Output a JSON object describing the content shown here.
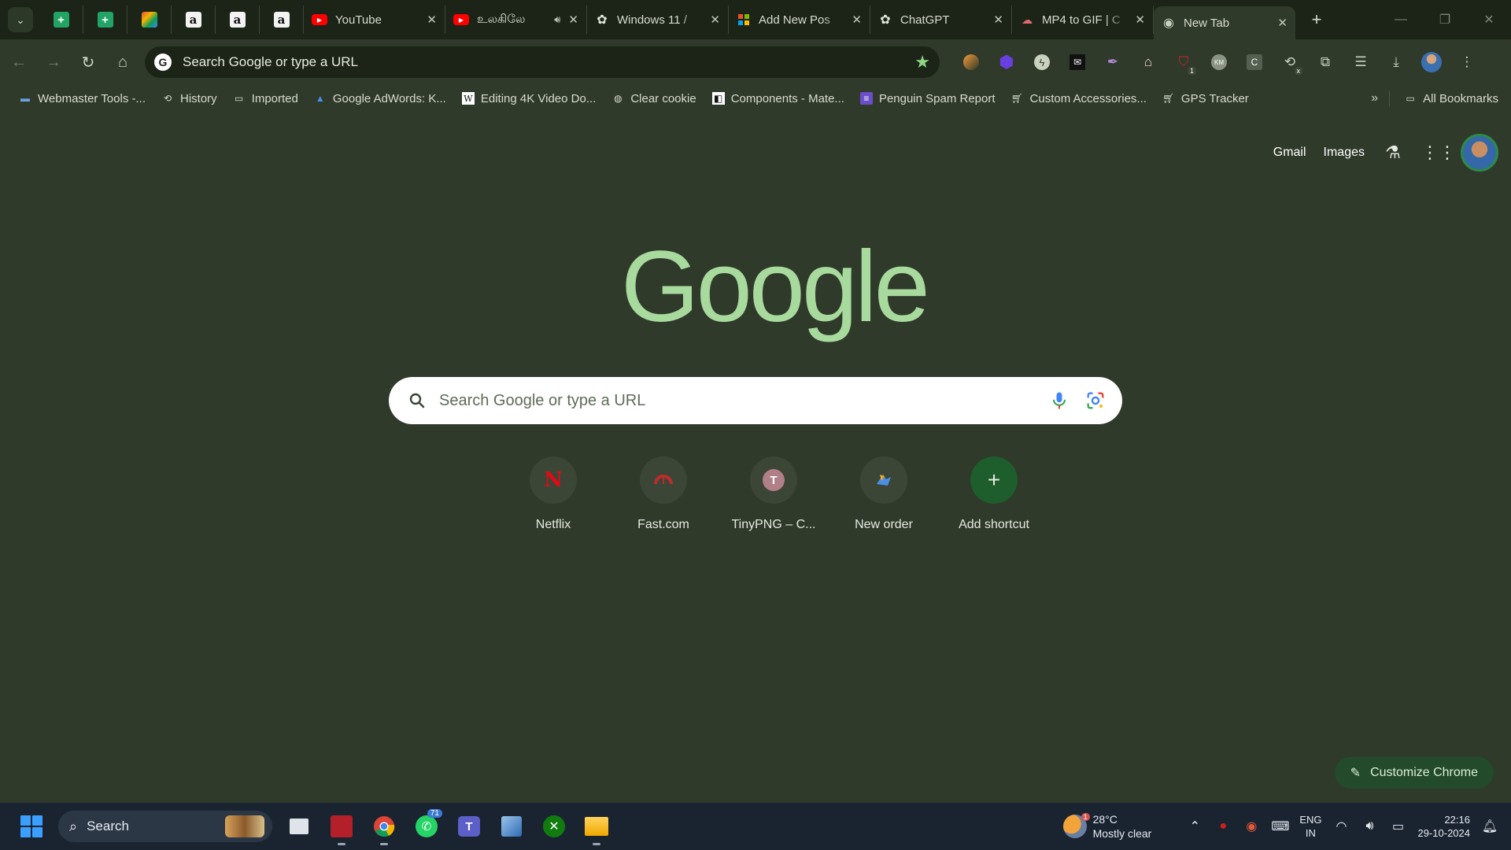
{
  "tabs": {
    "pinned": [
      {
        "icon": "google-sheets-icon",
        "glyph": "+"
      },
      {
        "icon": "google-sheets-icon",
        "glyph": "+"
      },
      {
        "icon": "multicolor-app-icon",
        "glyph": ""
      },
      {
        "icon": "amazon-icon",
        "glyph": "a"
      },
      {
        "icon": "amazon-icon",
        "glyph": "a"
      },
      {
        "icon": "amazon-icon",
        "glyph": "a"
      }
    ],
    "items": [
      {
        "label": "YouTube",
        "icon": "youtube-icon"
      },
      {
        "label": "உலகிலே",
        "icon": "youtube-icon",
        "audio": true
      },
      {
        "label": "Windows 11 /",
        "icon": "chatgpt-icon"
      },
      {
        "label": "Add New Pos",
        "icon": "wordpress-grid-icon"
      },
      {
        "label": "ChatGPT",
        "icon": "chatgpt-icon"
      },
      {
        "label": "MP4 to GIF | C",
        "icon": "cloud-icon"
      },
      {
        "label": "New Tab",
        "icon": "chrome-icon",
        "active": true
      }
    ]
  },
  "omnibox": {
    "placeholder": "Search Google or type a URL"
  },
  "bookmarks": [
    {
      "label": "Webmaster Tools -...",
      "icon": "webmaster-icon"
    },
    {
      "label": "History",
      "icon": "history-icon"
    },
    {
      "label": "Imported",
      "icon": "folder-icon"
    },
    {
      "label": "Google AdWords: K...",
      "icon": "adwords-icon"
    },
    {
      "label": "Editing 4K Video Do...",
      "icon": "wikipedia-icon"
    },
    {
      "label": "Clear cookie",
      "icon": "globe-icon"
    },
    {
      "label": "Components - Mate...",
      "icon": "material-icon"
    },
    {
      "label": "Penguin Spam Report",
      "icon": "form-icon"
    },
    {
      "label": "Custom Accessories...",
      "icon": "cart-icon"
    },
    {
      "label": "GPS Tracker",
      "icon": "cart-icon"
    }
  ],
  "all_bookmarks_label": "All Bookmarks",
  "ntp": {
    "gmail": "Gmail",
    "images": "Images",
    "logo_text": "Google",
    "search_placeholder": "Search Google or type a URL",
    "shortcuts": [
      {
        "label": "Netflix",
        "glyph": "N"
      },
      {
        "label": "Fast.com",
        "glyph": ""
      },
      {
        "label": "TinyPNG – C...",
        "glyph": "T"
      },
      {
        "label": "New order",
        "glyph": ""
      },
      {
        "label": "Add shortcut",
        "glyph": "+"
      }
    ],
    "customize_label": "Customize Chrome"
  },
  "taskbar": {
    "search_label": "Search",
    "whatsapp_badge": "71",
    "weather": {
      "temp": "28°C",
      "condition": "Mostly clear",
      "badge": "1"
    },
    "lang_top": "ENG",
    "lang_bottom": "IN",
    "time": "22:16",
    "date": "29-10-2024"
  },
  "colors": {
    "accent": "#a8d99d",
    "background": "#2f3a2b",
    "tabstrip": "#1c2418"
  }
}
